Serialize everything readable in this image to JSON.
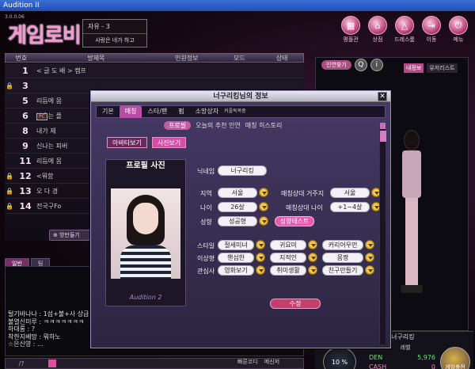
{
  "window": {
    "title": "Audition II"
  },
  "version": "3.0.0.06",
  "logo": "게임로비",
  "room_info": {
    "channel": "자유 - 3",
    "message": "사랑은 네가 하고"
  },
  "top_nav": [
    {
      "label": "평플관",
      "icon": "building-icon"
    },
    {
      "label": "상점",
      "icon": "shop-icon"
    },
    {
      "label": "드레스룸",
      "icon": "hanger-icon"
    },
    {
      "label": "이동",
      "icon": "door-icon"
    },
    {
      "label": "메뉴",
      "icon": "power-icon"
    }
  ],
  "room_list": {
    "headers": [
      "번호",
      "방제목",
      "인원정보",
      "모드",
      "상태"
    ],
    "rows": [
      {
        "num": "1",
        "name": "< 글 도 배 > 캠프",
        "locked": false
      },
      {
        "num": "3",
        "name": "",
        "locked": true
      },
      {
        "num": "5",
        "name": "리듬에 몸",
        "locked": false
      },
      {
        "num": "6",
        "name": "날으는 플",
        "locked": false,
        "pc": true
      },
      {
        "num": "8",
        "name": "내가 제",
        "locked": false
      },
      {
        "num": "9",
        "name": "신나는 피버",
        "locked": false
      },
      {
        "num": "11",
        "name": "리듬에 몸",
        "locked": false
      },
      {
        "num": "12",
        "name": "<뭐함",
        "locked": true
      },
      {
        "num": "13",
        "name": "오 다 경",
        "locked": true
      },
      {
        "num": "14",
        "name": "전국구Fo",
        "locked": true
      }
    ],
    "make_room": "방만들기"
  },
  "chat": {
    "tabs": [
      "일반",
      "팀"
    ],
    "lines": [
      "털기바나나 : 1섬+불+사 상급 꼬",
      "불열신미루 : ㅋㅋㅋㅋㅋㅋㅋ",
      "하대롱 : ?",
      "착한지베망 : 뭐하노",
      "☆은신영 : ..."
    ],
    "input": "/?",
    "options": [
      "빠른코디",
      "메신저"
    ]
  },
  "right_panel": {
    "tabs": [
      "인연찾기",
      "내정보",
      "유저리스트"
    ],
    "char_name": "너구리킹",
    "level_label": "레벨",
    "gauge": "10 %",
    "currency": [
      {
        "name": "DEN",
        "value": "5,976"
      },
      {
        "name": "CASH",
        "value": "0"
      }
    ],
    "game_charge": "게임충전"
  },
  "dialog": {
    "title": "너구리킹님의 정보",
    "tabs": [
      "기본",
      "매칭",
      "스타/팬",
      "펌",
      "소망상자",
      "커플독목중"
    ],
    "active_tab": "매칭",
    "subtabs": [
      "프로필",
      "오늘의 추천 인연",
      "매칭 히스토리"
    ],
    "view_buttons": [
      "아바타보기",
      "사진보기"
    ],
    "photo_title": "프로필 사진",
    "signature": "Audition 2",
    "fields": {
      "nickname": {
        "label": "닉네임",
        "value": "너구리킹"
      },
      "region": {
        "label": "지역",
        "value": "서울"
      },
      "match_region": {
        "label": "매칭상대 거주지",
        "value": "서울"
      },
      "age": {
        "label": "나이",
        "value": "26살"
      },
      "match_age": {
        "label": "매칭상대 나이",
        "value": "+1~4살"
      },
      "personality": {
        "label": "성향",
        "value": "성공형",
        "test": "성향테스트"
      },
      "style": {
        "label": "스타일",
        "values": [
          "절세미녀",
          "귀요미",
          "커리어우먼"
        ]
      },
      "ideal": {
        "label": "이상형",
        "values": [
          "핸섬한",
          "지적인",
          "몸짱"
        ]
      },
      "interest": {
        "label": "관심사",
        "values": [
          "영화보기",
          "취미생활",
          "친구만들기"
        ]
      }
    },
    "edit_button": "수정"
  }
}
